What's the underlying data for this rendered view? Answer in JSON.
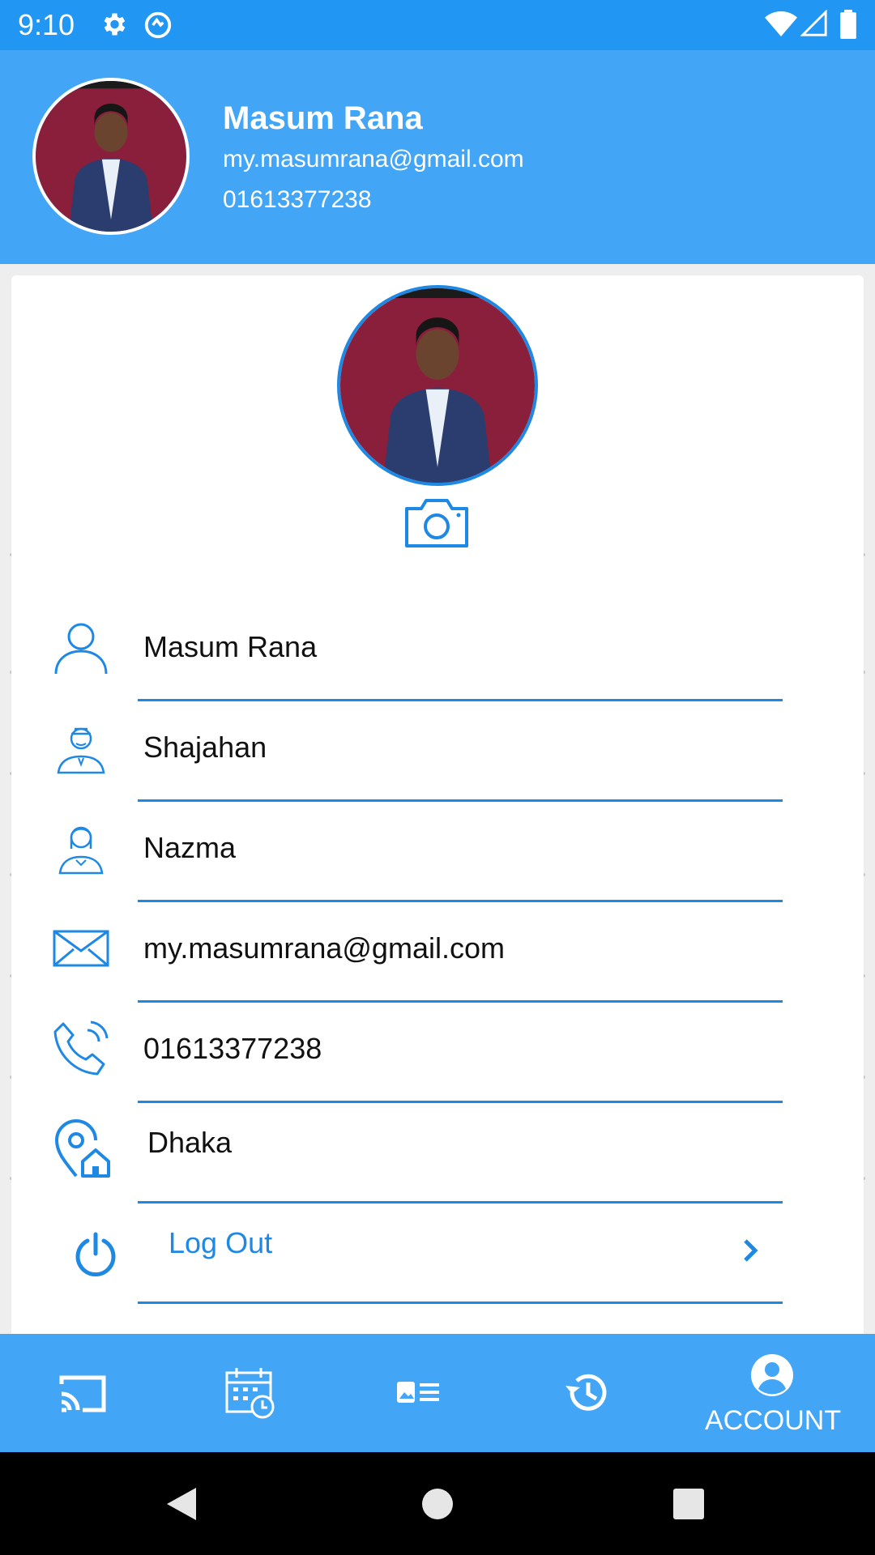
{
  "status_bar": {
    "time": "9:10"
  },
  "header": {
    "name": "Masum Rana",
    "email": "my.masumrana@gmail.com",
    "phone": "01613377238"
  },
  "profile_fields": [
    {
      "icon": "person-icon",
      "value": "Masum Rana"
    },
    {
      "icon": "father-icon",
      "value": "Shajahan"
    },
    {
      "icon": "mother-icon",
      "value": "Nazma"
    },
    {
      "icon": "email-icon",
      "value": "my.masumrana@gmail.com"
    },
    {
      "icon": "phone-icon",
      "value": "01613377238"
    },
    {
      "icon": "location-home-icon",
      "value": "Dhaka"
    }
  ],
  "logout": {
    "label": "Log Out"
  },
  "bottom_nav": {
    "items": [
      "cast-icon",
      "calendar-schedule-icon",
      "gallery-list-icon",
      "history-icon",
      "account-icon"
    ],
    "active_label": "ACCOUNT"
  },
  "colors": {
    "primary": "#42a5f5",
    "status": "#2196f3",
    "accent": "#1e88e5"
  }
}
